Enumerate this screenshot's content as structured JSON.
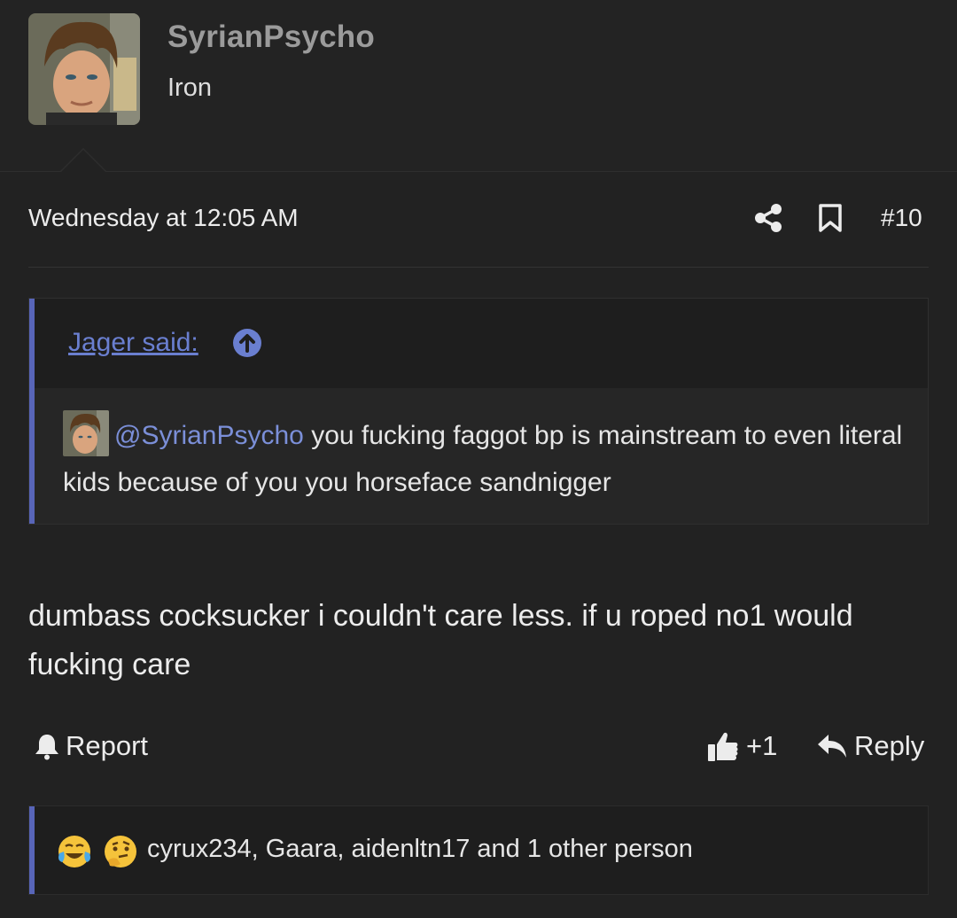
{
  "user": {
    "username": "SyrianPsycho",
    "title": "Iron"
  },
  "message": {
    "timestamp": "Wednesday at 12:05 AM",
    "post_number": "#10",
    "body": "dumbass cocksucker i couldn't care less. if u roped no1 would fucking care"
  },
  "quote": {
    "author_label": "Jager said:",
    "mention": "@SyrianPsycho",
    "text": " you fucking faggot bp is mainstream to even literal kids because of you you horseface sandnigger"
  },
  "actions": {
    "report_label": "Report",
    "like_label": "+1",
    "reply_label": "Reply"
  },
  "reactions": {
    "emojis": [
      "face-with-tears-of-joy",
      "thinking-face"
    ],
    "summary": "cyrux234, Gaara, aidenltn17 and 1 other person"
  },
  "colors": {
    "background": "#222222",
    "accent": "#5865b8",
    "link": "#6a7fd0",
    "username": "#9b9b9b"
  }
}
